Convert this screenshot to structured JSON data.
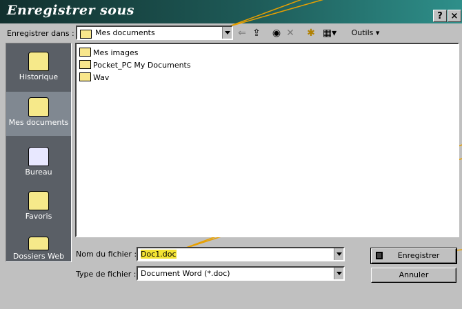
{
  "window": {
    "title": "Enregistrer sous",
    "help_button": "?",
    "close_button": "×"
  },
  "save_in": {
    "label": "Enregistrer dans :",
    "value": "Mes documents"
  },
  "toolbar": {
    "tools_label": "Outils"
  },
  "places": [
    {
      "label": "Historique"
    },
    {
      "label": "Mes documents"
    },
    {
      "label": "Bureau"
    },
    {
      "label": "Favoris"
    },
    {
      "label": "Dossiers Web"
    }
  ],
  "files": [
    {
      "name": "Mes images"
    },
    {
      "name": "Pocket_PC My Documents"
    },
    {
      "name": "Wav"
    }
  ],
  "filename": {
    "label": "Nom du fichier :",
    "value": "Doc1.doc"
  },
  "filetype": {
    "label": "Type de fichier :",
    "value": "Document Word (*.doc)"
  },
  "buttons": {
    "save": "Enregistrer",
    "cancel": "Annuler"
  }
}
